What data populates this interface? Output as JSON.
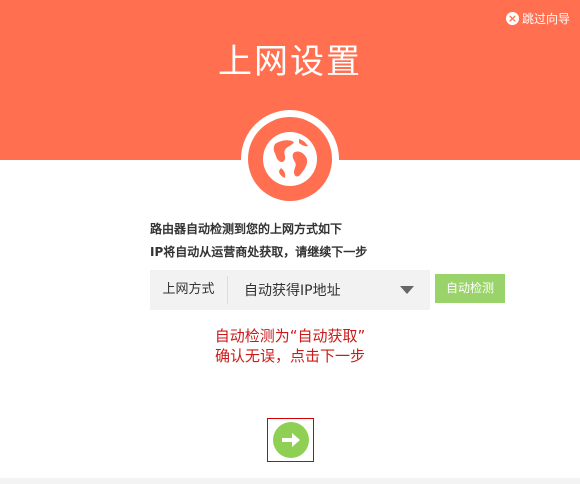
{
  "header": {
    "title": "上网设置",
    "skip_label": "跳过向导",
    "skip_icon": "close-circle-icon",
    "bg_color": "#ff6f50"
  },
  "main": {
    "globe_icon": "globe-icon",
    "description": [
      "路由器自动检测到您的上网方式如下",
      "IP将自动从运营商处获取，请继续下一步"
    ],
    "connection": {
      "label": "上网方式",
      "selected": "自动获得IP地址"
    },
    "auto_detect_button": "自动检测",
    "note": [
      "自动检测为“自动获取”",
      "确认无误，点击下一步"
    ],
    "next_icon": "arrow-right-icon"
  },
  "colors": {
    "accent": "#ff6f50",
    "button_green": "#99d36a",
    "note_red": "#cc1a1a"
  }
}
